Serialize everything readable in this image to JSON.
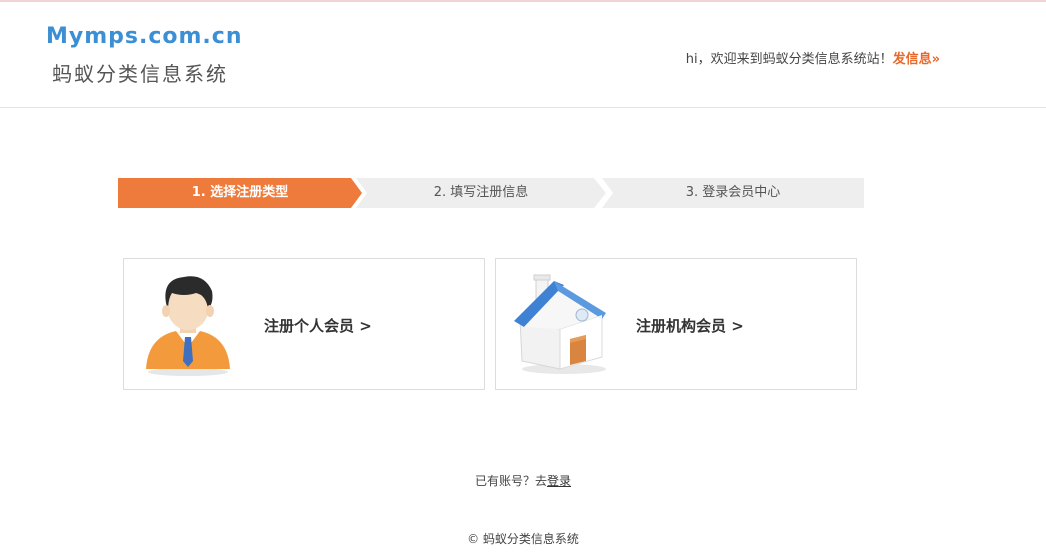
{
  "header": {
    "logo_en": "Mymps.com.cn",
    "logo_cn": "蚂蚁分类信息系统",
    "welcome_text": "hi，欢迎来到蚂蚁分类信息系统站！",
    "post_link": "发信息»"
  },
  "steps": [
    {
      "label": "1. 选择注册类型",
      "active": true
    },
    {
      "label": "2. 填写注册信息",
      "active": false
    },
    {
      "label": "3. 登录会员中心",
      "active": false
    }
  ],
  "cards": {
    "personal": {
      "label": "注册个人会员 >",
      "icon": "person-icon"
    },
    "org": {
      "label": "注册机构会员 >",
      "icon": "house-icon"
    }
  },
  "login": {
    "prompt": "已有账号？去",
    "link": "登录"
  },
  "footer": {
    "text": "© 蚂蚁分类信息系统"
  },
  "colors": {
    "accent": "#ee7b3c",
    "logo_blue": "#3c8fd4",
    "step_inactive": "#eeeeee"
  }
}
